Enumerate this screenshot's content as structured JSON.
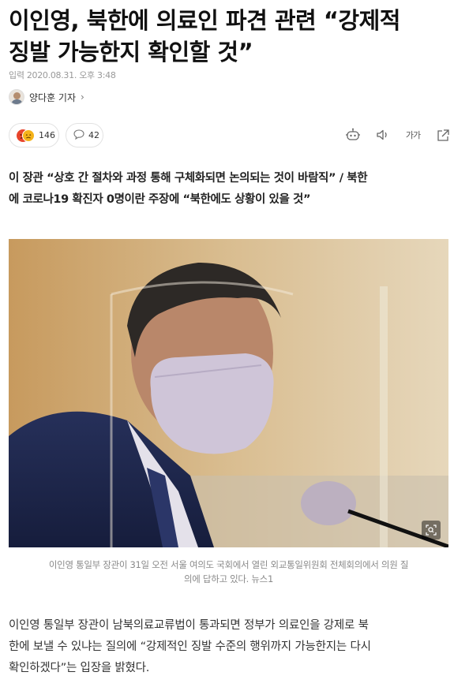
{
  "article": {
    "headline_line1": "이인영, 북한에 의료인 파견 관련 “강제적",
    "headline_line2": "징발 가능한지 확인할 것”",
    "published": "입력 2020.08.31. 오후 3:48",
    "reporter": "양다훈 기자",
    "reporter_chevron": "›",
    "subhead_line1": "이 장관 “상호 간 절차와 과정 통해 구체화되면 논의되는 것이 바람직” / 북한",
    "subhead_line2": "에 코로나19 확진자 0명이란 주장에 “북한에도 상황이 있을 것”",
    "caption_line1": "이인영 통일부 장관이 31일 오전 서울 여의도 국회에서 열린 외교통일위원회 전체회의에서 의원 질",
    "caption_line2": "의에 답하고 있다. 뉴스1",
    "body_line1": "이인영 통일부 장관이 남북의료교류법이 통과되면 정부가 의료인을 강제로 북",
    "body_line2": "한에 보낼 수 있냐는 질의에 “강제적인 징발 수준의 행위까지 가능한지는 다시",
    "body_line3": "확인하겠다”는 입장을 밝혔다."
  },
  "reactions": {
    "reaction_count": "146",
    "comment_count": "42"
  },
  "toolbar": {
    "font_size_label": "가가",
    "icons": [
      "robot-summary-icon",
      "speaker-icon",
      "font-size-icon",
      "share-icon"
    ]
  },
  "colors": {
    "headline": "#111111",
    "meta": "#999999",
    "caption": "#8a8a8a",
    "reaction_red": "#e8452c",
    "reaction_yellow": "#f5b31a"
  }
}
